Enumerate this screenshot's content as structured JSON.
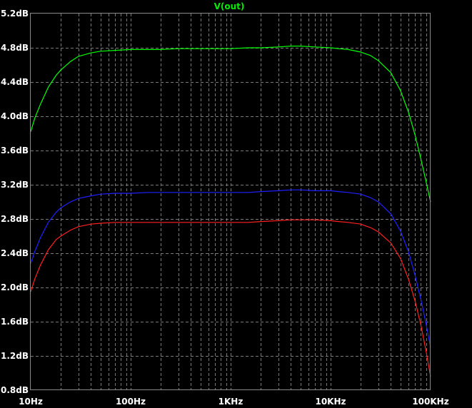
{
  "chart_data": {
    "type": "line",
    "title": "V(out)",
    "x_scale": "log",
    "xlim": [
      10,
      100000
    ],
    "ylim": [
      0.8,
      5.2
    ],
    "x_ticks": [
      {
        "value": 10,
        "label": "10Hz"
      },
      {
        "value": 100,
        "label": "100Hz"
      },
      {
        "value": 1000,
        "label": "1KHz"
      },
      {
        "value": 10000,
        "label": "10KHz"
      },
      {
        "value": 100000,
        "label": "100KHz"
      }
    ],
    "y_ticks": [
      {
        "value": 0.8,
        "label": "0.8dB"
      },
      {
        "value": 1.2,
        "label": "1.2dB"
      },
      {
        "value": 1.6,
        "label": "1.6dB"
      },
      {
        "value": 2.0,
        "label": "2.0dB"
      },
      {
        "value": 2.4,
        "label": "2.4dB"
      },
      {
        "value": 2.8,
        "label": "2.8dB"
      },
      {
        "value": 3.2,
        "label": "3.2dB"
      },
      {
        "value": 3.6,
        "label": "3.6dB"
      },
      {
        "value": 4.0,
        "label": "4.0dB"
      },
      {
        "value": 4.4,
        "label": "4.4dB"
      },
      {
        "value": 4.8,
        "label": "4.8dB"
      },
      {
        "value": 5.2,
        "label": "5.2dB"
      }
    ],
    "grid": true,
    "colors": {
      "background": "#000000",
      "title": "#00ee00",
      "tick_text": "#ffffff",
      "grid": "#7a7a7a"
    },
    "series": [
      {
        "color": "#00ff00",
        "x": [
          10,
          11,
          12.5,
          15,
          18,
          20,
          25,
          30,
          40,
          50,
          70,
          100,
          150,
          200,
          300,
          500,
          700,
          1000,
          1500,
          2000,
          3000,
          4000,
          5000,
          7000,
          10000,
          12000,
          15000,
          20000,
          25000,
          30000,
          40000,
          50000,
          60000,
          70000,
          80000,
          90000,
          100000
        ],
        "y": [
          3.82,
          3.98,
          4.14,
          4.34,
          4.48,
          4.54,
          4.64,
          4.7,
          4.74,
          4.76,
          4.77,
          4.78,
          4.78,
          4.78,
          4.79,
          4.79,
          4.79,
          4.79,
          4.8,
          4.8,
          4.81,
          4.82,
          4.82,
          4.81,
          4.8,
          4.79,
          4.78,
          4.75,
          4.71,
          4.65,
          4.51,
          4.3,
          4.05,
          3.78,
          3.5,
          3.24,
          3.0
        ]
      },
      {
        "color": "#2020ff",
        "x": [
          10,
          11,
          12.5,
          15,
          18,
          20,
          25,
          30,
          40,
          50,
          70,
          100,
          150,
          200,
          300,
          500,
          700,
          1000,
          1500,
          2000,
          3000,
          4000,
          5000,
          7000,
          10000,
          12000,
          15000,
          20000,
          25000,
          30000,
          40000,
          50000,
          60000,
          70000,
          80000,
          90000,
          100000
        ],
        "y": [
          2.28,
          2.42,
          2.58,
          2.76,
          2.88,
          2.93,
          3.0,
          3.04,
          3.07,
          3.09,
          3.1,
          3.1,
          3.11,
          3.11,
          3.11,
          3.11,
          3.11,
          3.11,
          3.11,
          3.12,
          3.13,
          3.14,
          3.14,
          3.13,
          3.13,
          3.12,
          3.11,
          3.09,
          3.05,
          3.0,
          2.86,
          2.66,
          2.42,
          2.14,
          1.86,
          1.58,
          1.3
        ]
      },
      {
        "color": "#ff2020",
        "x": [
          10,
          11,
          12.5,
          15,
          18,
          20,
          25,
          30,
          40,
          50,
          70,
          100,
          150,
          200,
          300,
          500,
          700,
          1000,
          1500,
          2000,
          3000,
          4000,
          5000,
          7000,
          10000,
          12000,
          15000,
          20000,
          25000,
          30000,
          40000,
          50000,
          60000,
          70000,
          80000,
          90000,
          100000
        ],
        "y": [
          1.95,
          2.1,
          2.26,
          2.44,
          2.56,
          2.6,
          2.67,
          2.71,
          2.74,
          2.75,
          2.76,
          2.76,
          2.76,
          2.76,
          2.76,
          2.76,
          2.76,
          2.76,
          2.76,
          2.77,
          2.78,
          2.79,
          2.79,
          2.79,
          2.78,
          2.77,
          2.76,
          2.74,
          2.7,
          2.65,
          2.52,
          2.34,
          2.1,
          1.84,
          1.56,
          1.26,
          0.96
        ]
      }
    ]
  }
}
